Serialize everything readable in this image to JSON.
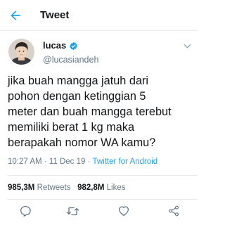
{
  "header": {
    "back_icon": "arrow-left-icon",
    "title": "Tweet"
  },
  "author": {
    "display_name": "lucas",
    "verified": true,
    "username": "@lucasiandeh"
  },
  "tweet": {
    "text": "jika buah mangga jatuh dari\npohon dengan ketinggian 5\nmeter dan buah mangga terebut\nmemiliki berat 1 kg maka\nberapakah nomor WA kamu?",
    "time": "10:27 AM",
    "date": "11 Dec 19",
    "separator": "·",
    "client": "Twitter for Android"
  },
  "stats": {
    "retweets_count": "985,3M",
    "retweets_label": "Retweets",
    "likes_count": "982,8M",
    "likes_label": "Likes"
  },
  "actions": [
    "reply-icon",
    "retweet-icon",
    "like-icon",
    "share-icon"
  ],
  "colors": {
    "accent": "#1da1f2",
    "text": "#14171a",
    "secondary": "#657786",
    "divider": "#e6ecf0"
  }
}
